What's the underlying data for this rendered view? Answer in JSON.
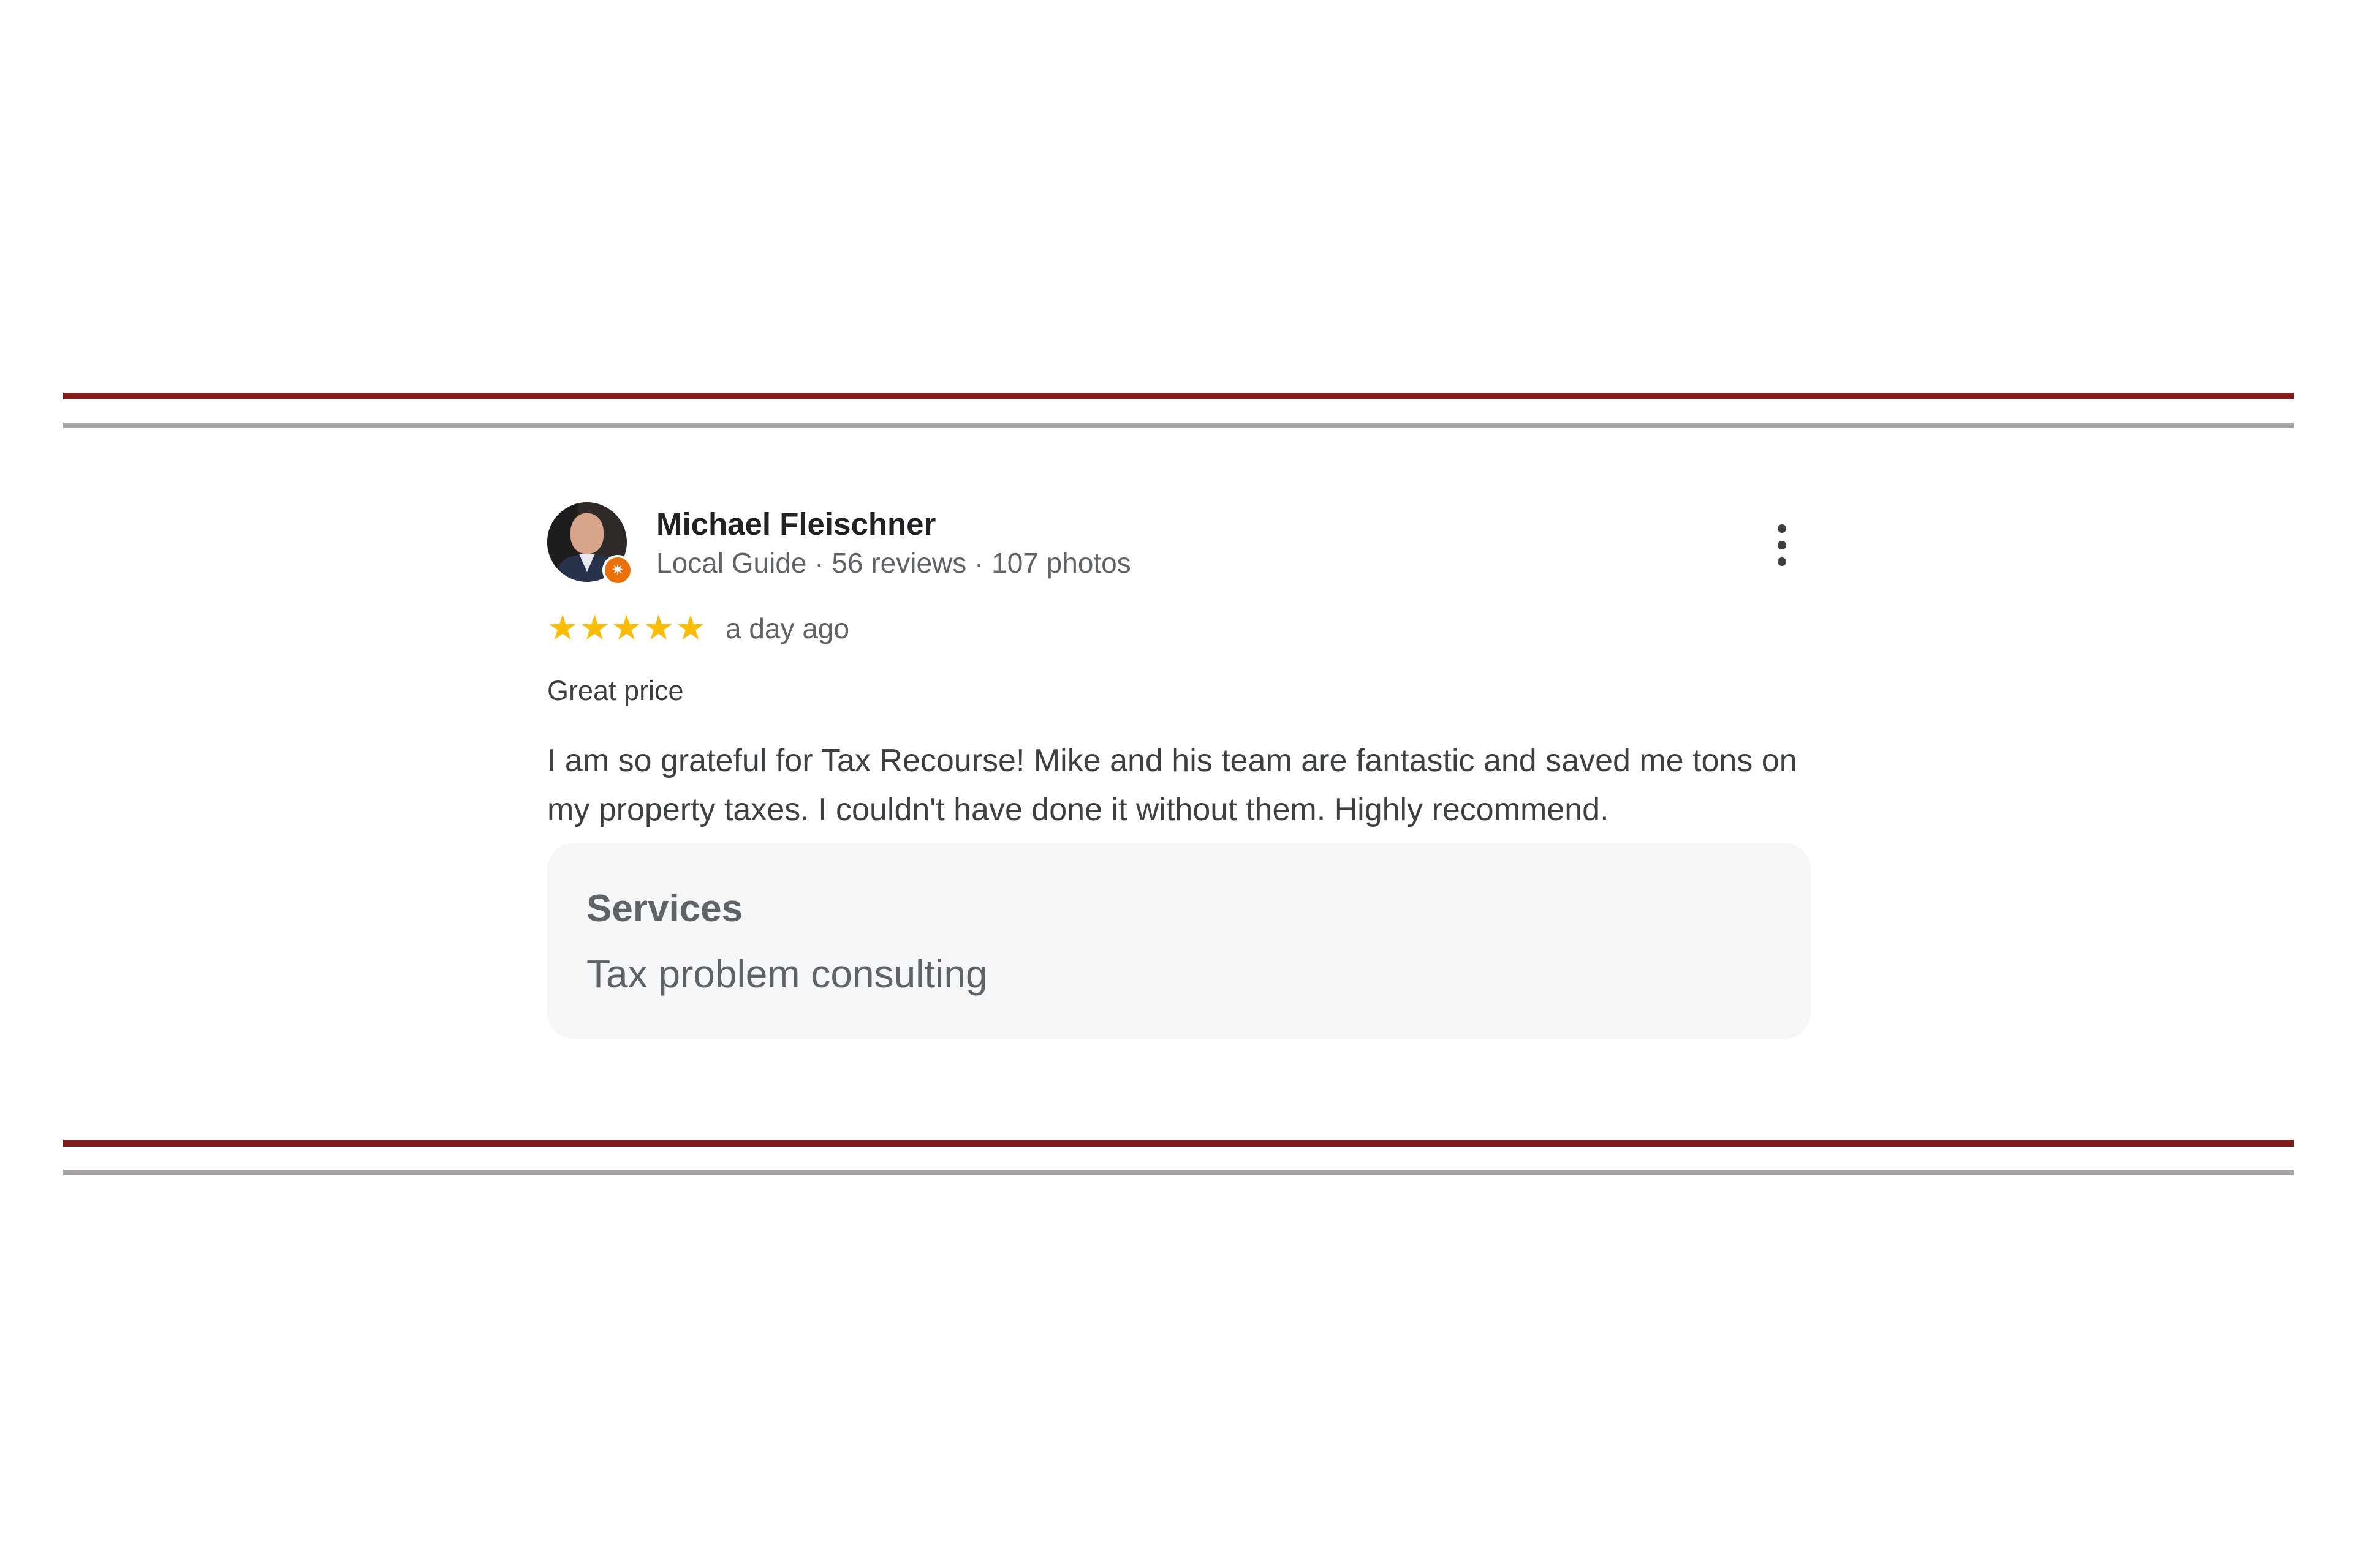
{
  "review": {
    "author": "Michael Fleischner",
    "author_meta": "Local Guide · 56 reviews · 107 photos",
    "rating": 5,
    "stars": [
      "★",
      "★",
      "★",
      "★",
      "★"
    ],
    "date": "a day ago",
    "title": "Great price",
    "text": "I am so grateful for Tax Recourse! Mike and his team are fantastic and saved me tons on my property taxes. I couldn't have done it without them. Highly recommend.",
    "services_label": "Services",
    "services_value": "Tax problem consulting",
    "star_color": "#fbbc04",
    "badge_color": "#e8710a",
    "badge_icon": "local-guide-icon",
    "menu_icon": "more-vert-icon"
  },
  "divider_colors": {
    "primary": "#7f1d1d",
    "secondary": "#a8a3a3"
  }
}
